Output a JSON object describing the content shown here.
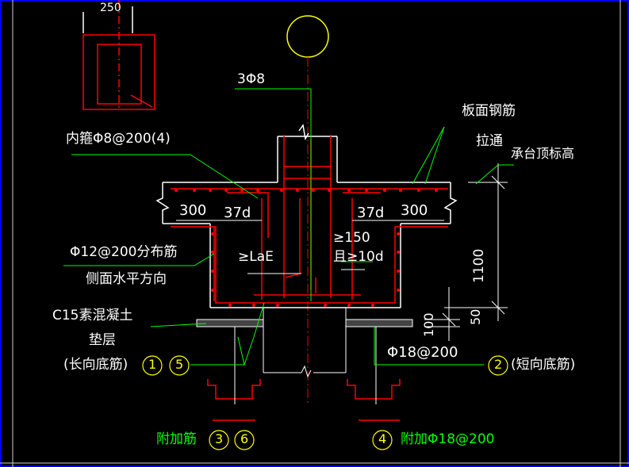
{
  "labels": {
    "top_dim": "250",
    "stirrup_3": "3Φ8",
    "inner_stirrup": "内箍Φ8@200(4)",
    "slab_top_rebar": "板面钢筋",
    "through": "拉通",
    "cap_top_elev": "承台顶标高",
    "dim_300_left": "300",
    "dim_37d_left": "37d",
    "dim_37d_right": "37d",
    "dim_300_right": "300",
    "ge150": "≥150",
    "ge10d": "且≥10d",
    "lae": "≥LaE",
    "dim_1100": "1100",
    "dim_50": "50",
    "dim_100": "100",
    "dist_bar": "Φ12@200分布筋",
    "side_horizontal": "侧面水平方向",
    "c15": "C15素混凝土",
    "cushion": "垫层",
    "long_bottom": "(长向底筋)",
    "bar_phi18": "Φ18@200",
    "short_bottom": "(短向底筋)",
    "extra_bar": "附加筋",
    "extra_phi18": "附加Φ18@200"
  },
  "markers": {
    "m1": "1",
    "m5": "5",
    "m2": "2",
    "m3": "3",
    "m6": "6",
    "m4": "4"
  },
  "colors": {
    "background": "#000000",
    "rebar": "#ff0000",
    "structure": "#ffffff",
    "leader": "#00ff00",
    "marker": "#ffff00",
    "frame": "#0000ff",
    "centerline": "#ff0000"
  }
}
